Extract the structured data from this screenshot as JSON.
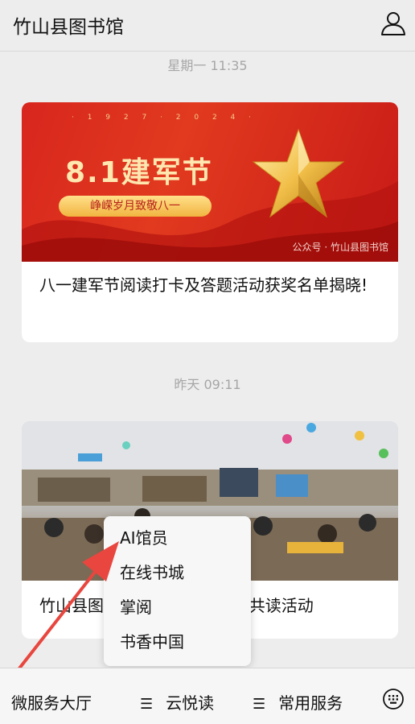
{
  "header": {
    "title": "竹山县图书馆",
    "user_icon": "user-icon"
  },
  "messages": [
    {
      "time": "星期一 11:35",
      "banner": {
        "dates": "· 1 9 2 7 · 2 0 2 4 ·",
        "headline": "8.1建军节",
        "pill": "峥嵘岁月致敬八一",
        "watermark": "公众号 · 竹山县图书馆"
      },
      "caption": "八一建军节阅读打卡及答题活动获奖名单揭晓!"
    },
    {
      "time": "昨天 09:11",
      "caption": "竹山县图书馆“书香伴夏”亲子共读活动"
    }
  ],
  "popup": {
    "items": [
      "AI馆员",
      "在线书城",
      "掌阅",
      "书香中国"
    ]
  },
  "bottom_menu": {
    "tab1": "微服务大厅",
    "tab2": "云悦读",
    "tab3": "常用服务",
    "hamburger": "☰",
    "keyboard_icon": "keyboard-icon"
  },
  "colors": {
    "bg": "#ededed",
    "banner_red": "#d8261e",
    "annotation_arrow": "#e8463f"
  }
}
